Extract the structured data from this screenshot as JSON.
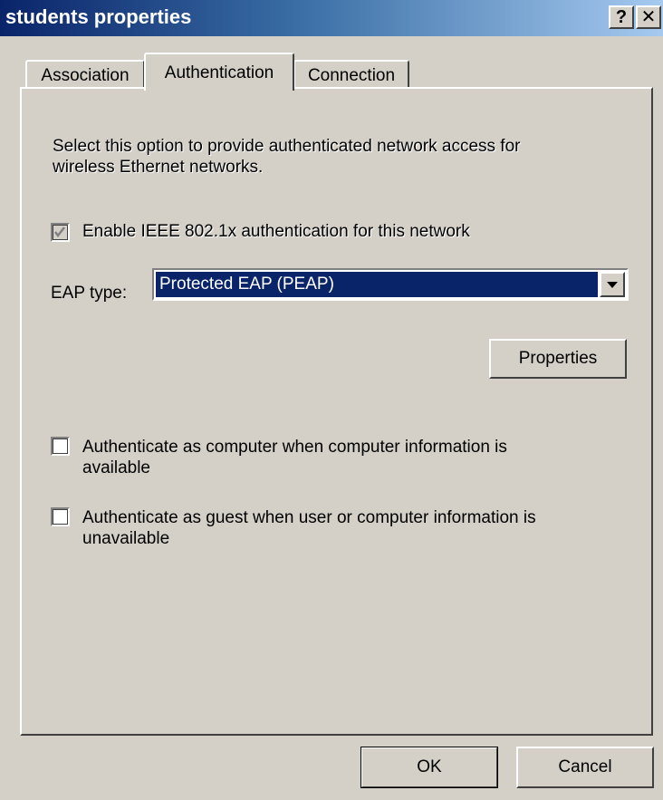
{
  "window": {
    "title": "students properties",
    "help_button": "?",
    "close_button": "✕"
  },
  "tabs": [
    {
      "label": "Association",
      "selected": false
    },
    {
      "label": "Authentication",
      "selected": true
    },
    {
      "label": "Connection",
      "selected": false
    }
  ],
  "authentication": {
    "description": "Select this option to provide authenticated network access for wireless Ethernet networks.",
    "description_line1": "Select this option to provide authenticated network access for",
    "description_line2": "wireless Ethernet networks.",
    "enable_8021x": {
      "label": "Enable IEEE 802.1x authentication for this network",
      "checked": true,
      "enabled": false
    },
    "eap_type_label": "EAP type:",
    "eap_type_value": "Protected EAP (PEAP)",
    "properties_button": "Properties",
    "auth_as_computer": {
      "line1": "Authenticate as computer when computer information is",
      "line2": "available",
      "checked": false
    },
    "auth_as_guest": {
      "line1": "Authenticate as guest when user or computer information is",
      "line2": "unavailable",
      "checked": false
    }
  },
  "footer": {
    "ok_label": "OK",
    "cancel_label": "Cancel"
  },
  "colors": {
    "titlebar_start": "#0a246a",
    "titlebar_end": "#a6caf0",
    "dialog_face": "#d4d0c8",
    "selection": "#0a246a",
    "disabled_text": "#8c8a84"
  }
}
